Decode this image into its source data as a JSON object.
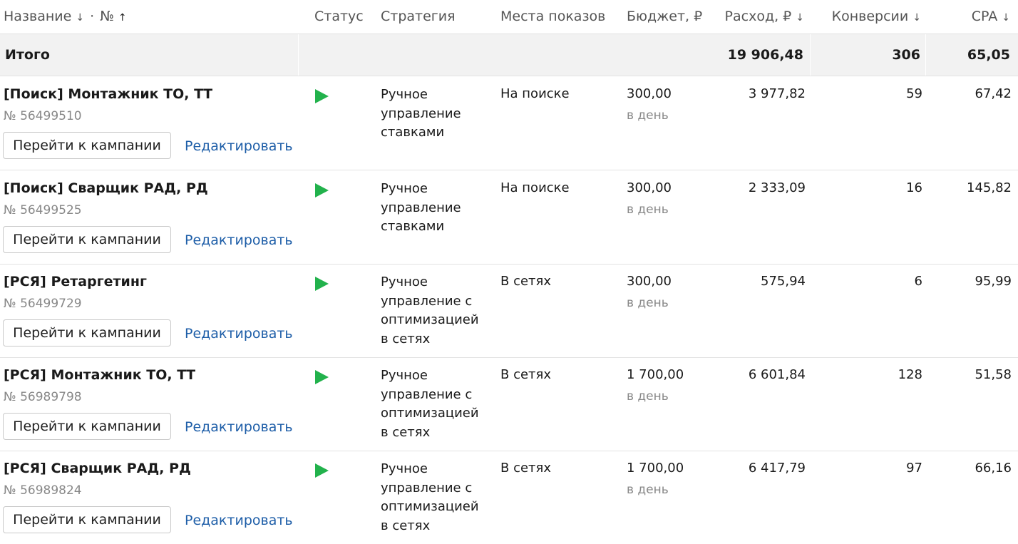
{
  "header": {
    "name": "Название",
    "name_sort": "↓",
    "dot": "·",
    "number": "№",
    "number_sort": "↑",
    "status": "Статус",
    "strategy": "Стратегия",
    "placements": "Места показов",
    "budget": "Бюджет, ₽",
    "spend": "Расход, ₽",
    "spend_sort": "↓",
    "conversions": "Конверсии",
    "conversions_sort": "↓",
    "cpa": "CPA",
    "cpa_sort": "↓"
  },
  "total": {
    "label": "Итого",
    "spend": "19 906,48",
    "conversions": "306",
    "cpa": "65,05"
  },
  "labels": {
    "go_button": "Перейти к кампании",
    "edit_link": "Редактировать",
    "per_day": "в день"
  },
  "colors": {
    "status_active": "#22b24c",
    "link": "#1e5ea8"
  },
  "campaigns": [
    {
      "name": "[Поиск] Монтажник ТО, ТТ",
      "number": "№ 56499510",
      "status_icon": "play-icon",
      "strategy": "Ручное управление ставками",
      "placement": "На поиске",
      "budget": "300,00",
      "spend": "3 977,82",
      "conversions": "59",
      "cpa": "67,42"
    },
    {
      "name": "[Поиск] Сварщик РАД, РД",
      "number": "№ 56499525",
      "status_icon": "play-icon",
      "strategy": "Ручное управление ставками",
      "placement": "На поиске",
      "budget": "300,00",
      "spend": "2 333,09",
      "conversions": "16",
      "cpa": "145,82"
    },
    {
      "name": "[РСЯ] Ретаргетинг",
      "number": "№ 56499729",
      "status_icon": "play-icon",
      "strategy": "Ручное управление с оптимизацией в сетях",
      "placement": "В сетях",
      "budget": "300,00",
      "spend": "575,94",
      "conversions": "6",
      "cpa": "95,99"
    },
    {
      "name": "[РСЯ] Монтажник ТО, ТТ",
      "number": "№ 56989798",
      "status_icon": "play-icon",
      "strategy": "Ручное управление с оптимизацией в сетях",
      "placement": "В сетях",
      "budget": "1 700,00",
      "spend": "6 601,84",
      "conversions": "128",
      "cpa": "51,58"
    },
    {
      "name": "[РСЯ] Сварщик РАД, РД",
      "number": "№ 56989824",
      "status_icon": "play-icon",
      "strategy": "Ручное управление с оптимизацией в сетях",
      "placement": "В сетях",
      "budget": "1 700,00",
      "spend": "6 417,79",
      "conversions": "97",
      "cpa": "66,16"
    }
  ]
}
